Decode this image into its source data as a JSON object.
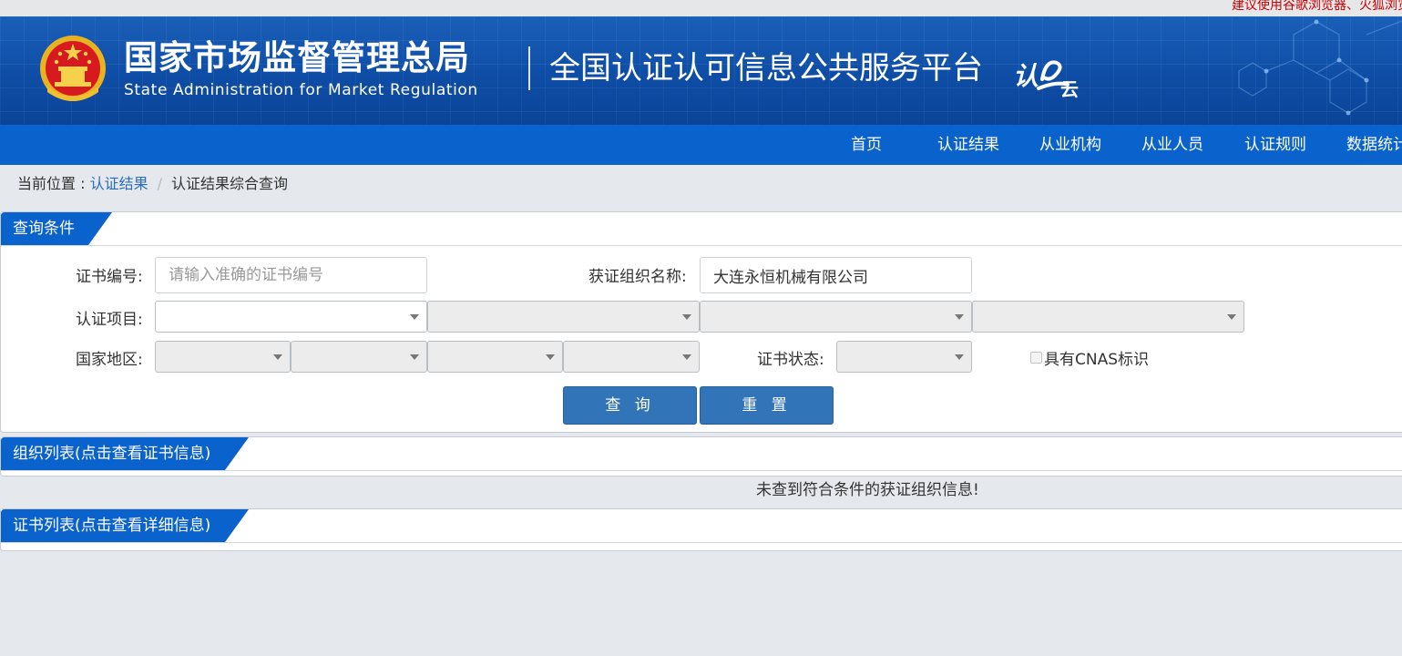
{
  "top_notice": "建议使用谷歌浏览器、火狐浏览器",
  "header": {
    "org_name_cn": "国家市场监督管理总局",
    "org_name_en": "State Administration  for  Market Regulation",
    "platform_title": "全国认证认可信息公共服务平台",
    "platform_logo": "认e云",
    "emblem_icon": "national-emblem-icon"
  },
  "nav": {
    "items": [
      "首页",
      "认证结果",
      "从业机构",
      "从业人员",
      "认证规则",
      "数据统计"
    ]
  },
  "breadcrumb": {
    "prefix": "当前位置 : ",
    "link": "认证结果",
    "separator": "/",
    "current": "认证结果综合查询"
  },
  "query_panel": {
    "title": "查询条件",
    "cert_no_label": "证书编号:",
    "cert_no_placeholder": "请输入准确的证书编号",
    "cert_no_value": "",
    "org_name_label": "获证组织名称:",
    "org_name_value": "大连永恒机械有限公司",
    "project_label": "认证项目:",
    "region_label": "国家地区:",
    "status_label": "证书状态:",
    "cnas_label": "具有CNAS标识",
    "search_button": "查 询",
    "reset_button": "重 置"
  },
  "org_list": {
    "title": "组织列表(点击查看证书信息)",
    "empty_message": "未查到符合条件的获证组织信息!"
  },
  "cert_list": {
    "title": "证书列表(点击查看详细信息)"
  },
  "colors": {
    "banner_blue": "#0e4da6",
    "nav_blue": "#0a62cc",
    "button_blue": "#3274b8",
    "link_blue": "#2a6cbd",
    "notice_red": "#cc0000"
  }
}
